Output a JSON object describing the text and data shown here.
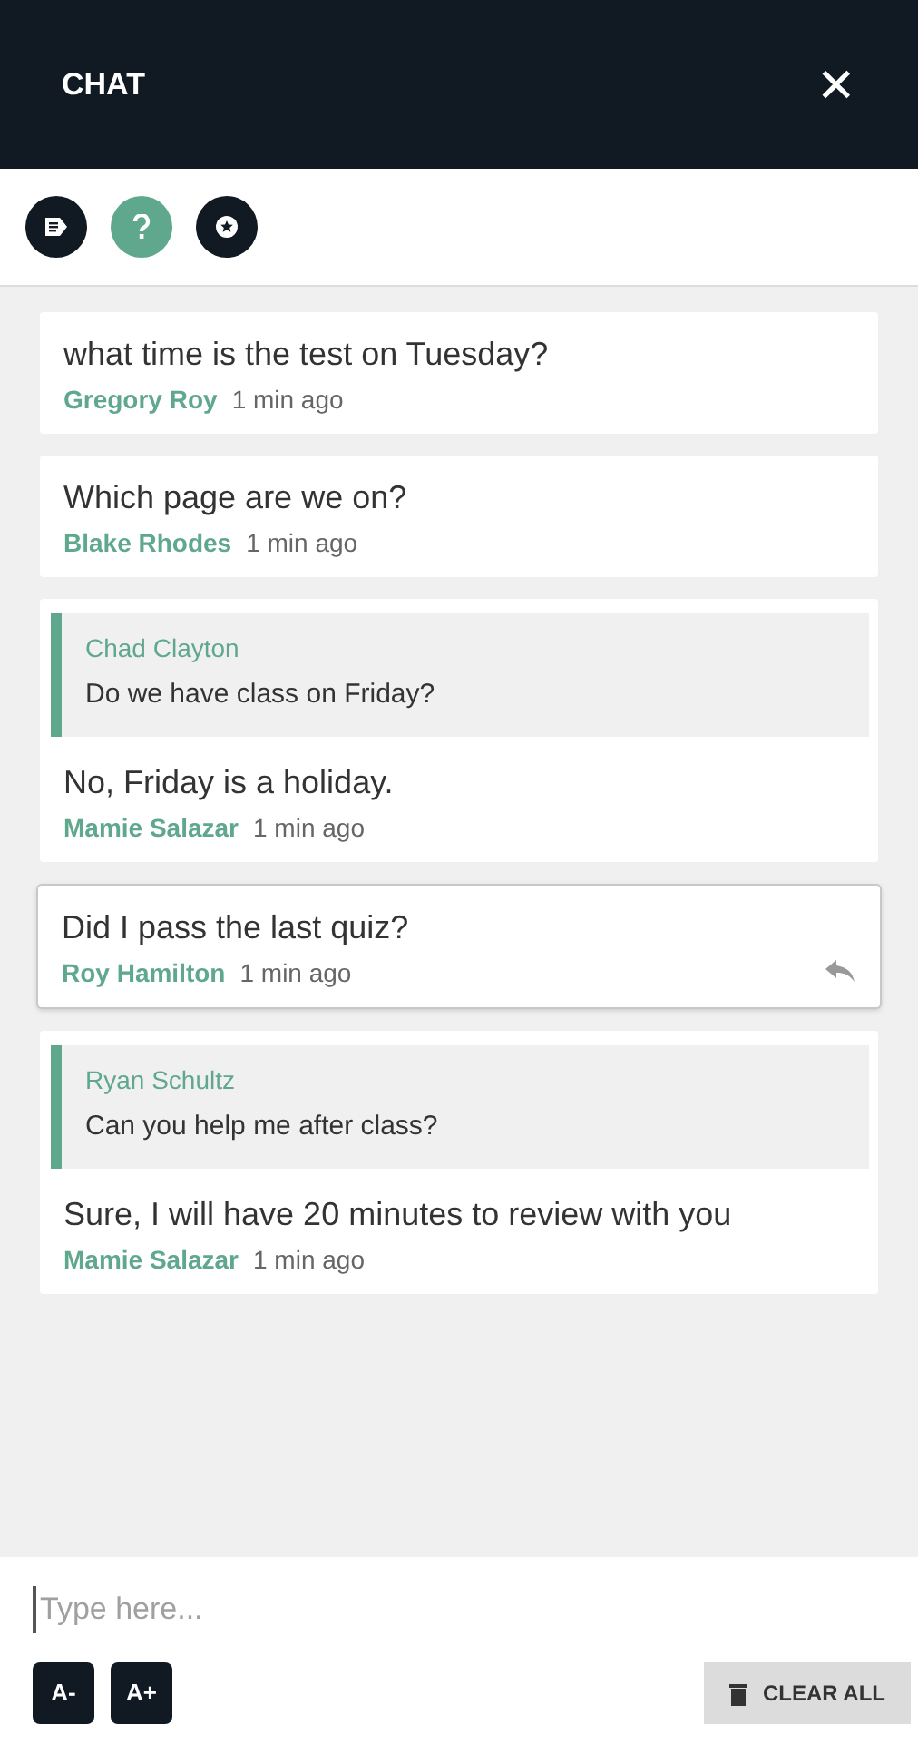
{
  "header": {
    "title": "CHAT",
    "close": "✕"
  },
  "toolbar": [
    {
      "kind": "note",
      "selected": false
    },
    {
      "kind": "help",
      "selected": true
    },
    {
      "kind": "star",
      "selected": false
    }
  ],
  "messages": [
    {
      "text": "what time is the test on Tuesday?",
      "author": "Gregory Roy",
      "time": "1 min ago",
      "selected": false
    },
    {
      "text": "Which page are we on?",
      "author": "Blake Rhodes",
      "time": "1 min ago",
      "selected": false
    },
    {
      "quote": {
        "author": "Chad Clayton",
        "text": "Do we have class on Friday?"
      },
      "text": "No, Friday is a holiday.",
      "author": "Mamie Salazar",
      "time": "1 min ago",
      "selected": false
    },
    {
      "text": "Did I pass the last quiz?",
      "author": "Roy Hamilton",
      "time": "1 min ago",
      "selected": true
    },
    {
      "quote": {
        "author": "Ryan Schultz",
        "text": "Can you help me after class?"
      },
      "text": "Sure, I will have 20 minutes to review with you",
      "author": "Mamie Salazar",
      "time": "1 min ago",
      "selected": false
    }
  ],
  "composer": {
    "placeholder": "Type here..."
  },
  "font_buttons": [
    "A-",
    "A+"
  ],
  "clear_button": "CLEAR ALL"
}
